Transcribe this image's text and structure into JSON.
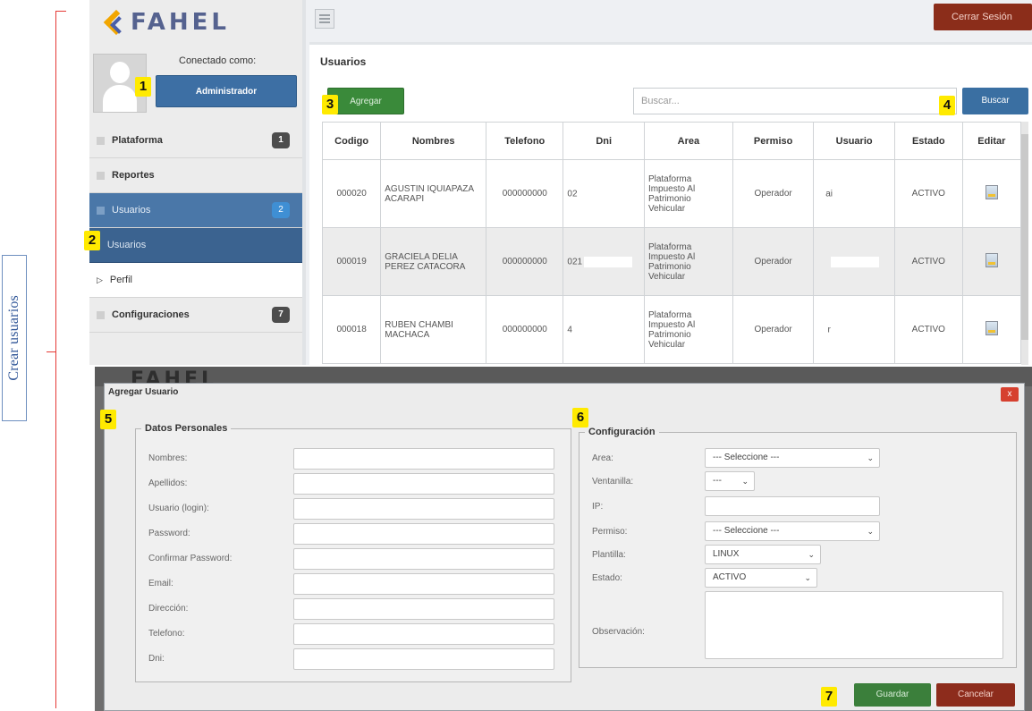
{
  "annotation": {
    "side_label": "Crear usuarios",
    "markers": [
      "1",
      "2",
      "3",
      "4",
      "5",
      "6",
      "7"
    ]
  },
  "sidebar": {
    "logo": "FAHEL",
    "connected_as": "Conectado como:",
    "role_button": "Administrador",
    "items": [
      {
        "label": "Plataforma",
        "badge": "1"
      },
      {
        "label": "Reportes",
        "badge": ""
      },
      {
        "label": "Usuarios",
        "badge": "2"
      },
      {
        "label": "Usuarios",
        "badge": ""
      },
      {
        "label": "Perfil",
        "badge": ""
      },
      {
        "label": "Configuraciones",
        "badge": "7"
      }
    ]
  },
  "header": {
    "logout": "Cerrar Sesión"
  },
  "users": {
    "title": "Usuarios",
    "add_button": "Agregar",
    "search_placeholder": "Buscar...",
    "search_button": "Buscar",
    "columns": [
      "Codigo",
      "Nombres",
      "Telefono",
      "Dni",
      "Area",
      "Permiso",
      "Usuario",
      "Estado",
      "Editar"
    ],
    "rows": [
      {
        "codigo": "000020",
        "nombres": "AGUSTIN IQUIAPAZA ACARAPI",
        "telefono": "000000000",
        "dni": "02",
        "area": "Plataforma Impuesto Al Patrimonio Vehicular",
        "permiso": "Operador",
        "usuario": "ai",
        "estado": "ACTIVO"
      },
      {
        "codigo": "000019",
        "nombres": "GRACIELA DELIA PEREZ CATACORA",
        "telefono": "000000000",
        "dni": "021",
        "area": "Plataforma Impuesto Al Patrimonio Vehicular",
        "permiso": "Operador",
        "usuario": "",
        "estado": "ACTIVO"
      },
      {
        "codigo": "000018",
        "nombres": "RUBEN CHAMBI MACHACA",
        "telefono": "000000000",
        "dni": "4",
        "area": "Plataforma Impuesto Al Patrimonio Vehicular",
        "permiso": "Operador",
        "usuario": "r",
        "estado": "ACTIVO"
      }
    ]
  },
  "dialog": {
    "background_logo": "FAHEL",
    "title": "Agregar Usuario",
    "close": "x",
    "personal": {
      "legend": "Datos Personales",
      "fields": [
        "Nombres:",
        "Apellidos:",
        "Usuario (login):",
        "Password:",
        "Confirmar Password:",
        "Email:",
        "Dirección:",
        "Telefono:",
        "Dni:"
      ]
    },
    "config": {
      "legend": "Configuración",
      "area_label": "Area:",
      "area_value": "--- Seleccione ---",
      "ventanilla_label": "Ventanilla:",
      "ventanilla_value": "---",
      "ip_label": "IP:",
      "permiso_label": "Permiso:",
      "permiso_value": "--- Seleccione ---",
      "plantilla_label": "Plantilla:",
      "plantilla_value": "LINUX",
      "estado_label": "Estado:",
      "estado_value": "ACTIVO",
      "observacion_label": "Observación:"
    },
    "save": "Guardar",
    "cancel": "Cancelar"
  }
}
